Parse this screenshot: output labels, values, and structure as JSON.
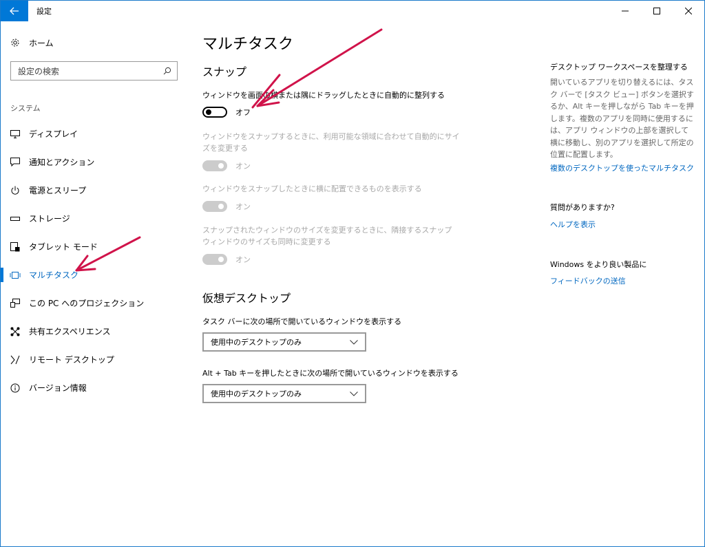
{
  "titlebar": {
    "title": "設定",
    "back_icon": "back-arrow-icon",
    "controls": [
      "minimize-icon",
      "maximize-icon",
      "close-icon"
    ]
  },
  "sidebar": {
    "home_label": "ホーム",
    "search_placeholder": "設定の検索",
    "section_label": "システム",
    "items": [
      {
        "label": "ディスプレイ",
        "icon": "display-icon"
      },
      {
        "label": "通知とアクション",
        "icon": "notification-icon"
      },
      {
        "label": "電源とスリープ",
        "icon": "power-icon"
      },
      {
        "label": "ストレージ",
        "icon": "storage-icon"
      },
      {
        "label": "タブレット モード",
        "icon": "tablet-mode-icon"
      },
      {
        "label": "マルチタスク",
        "icon": "multitasking-icon",
        "active": true
      },
      {
        "label": "この PC へのプロジェクション",
        "icon": "projection-icon"
      },
      {
        "label": "共有エクスペリエンス",
        "icon": "shared-experience-icon"
      },
      {
        "label": "リモート デスクトップ",
        "icon": "remote-desktop-icon"
      },
      {
        "label": "バージョン情報",
        "icon": "info-icon"
      }
    ]
  },
  "main": {
    "title": "マルチタスク",
    "snap": {
      "heading": "スナップ",
      "settings": [
        {
          "label": "ウィンドウを画面の横または隅にドラッグしたときに自動的に整列する",
          "state": "オフ",
          "enabled": true,
          "on": false
        },
        {
          "label": "ウィンドウをスナップするときに、利用可能な領域に合わせて自動的にサイズを変更する",
          "state": "オン",
          "enabled": false,
          "on": true
        },
        {
          "label": "ウィンドウをスナップしたときに横に配置できるものを表示する",
          "state": "オン",
          "enabled": false,
          "on": true
        },
        {
          "label": "スナップされたウィンドウのサイズを変更するときに、隣接するスナップ ウィンドウのサイズも同時に変更する",
          "state": "オン",
          "enabled": false,
          "on": true
        }
      ]
    },
    "virtual_desktops": {
      "heading": "仮想デスクトップ",
      "taskbar_label": "タスク バーに次の場所で開いているウィンドウを表示する",
      "taskbar_value": "使用中のデスクトップのみ",
      "alttab_label": "Alt + Tab キーを押したときに次の場所で開いているウィンドウを表示する",
      "alttab_value": "使用中のデスクトップのみ"
    }
  },
  "right": {
    "workspace_heading": "デスクトップ ワークスペースを整理する",
    "workspace_text": "開いているアプリを切り替えるには、タスク バーで [タスク ビュー] ボタンを選択するか、Alt キーを押しながら Tab キーを押します。複数のアプリを同時に使用するには、アプリ ウィンドウの上部を選択して横に移動し、別のアプリを選択して所定の位置に配置します。",
    "workspace_link": "複数のデスクトップを使ったマルチタスク",
    "question_heading": "質問がありますか?",
    "help_link": "ヘルプを表示",
    "feedback_heading": "Windows をより良い製品に",
    "feedback_link": "フィードバックの送信"
  },
  "colors": {
    "accent": "#0078d7",
    "link": "#0067c0",
    "annotation_arrow": "#d0134a",
    "disabled_text": "#a8a8a8"
  }
}
